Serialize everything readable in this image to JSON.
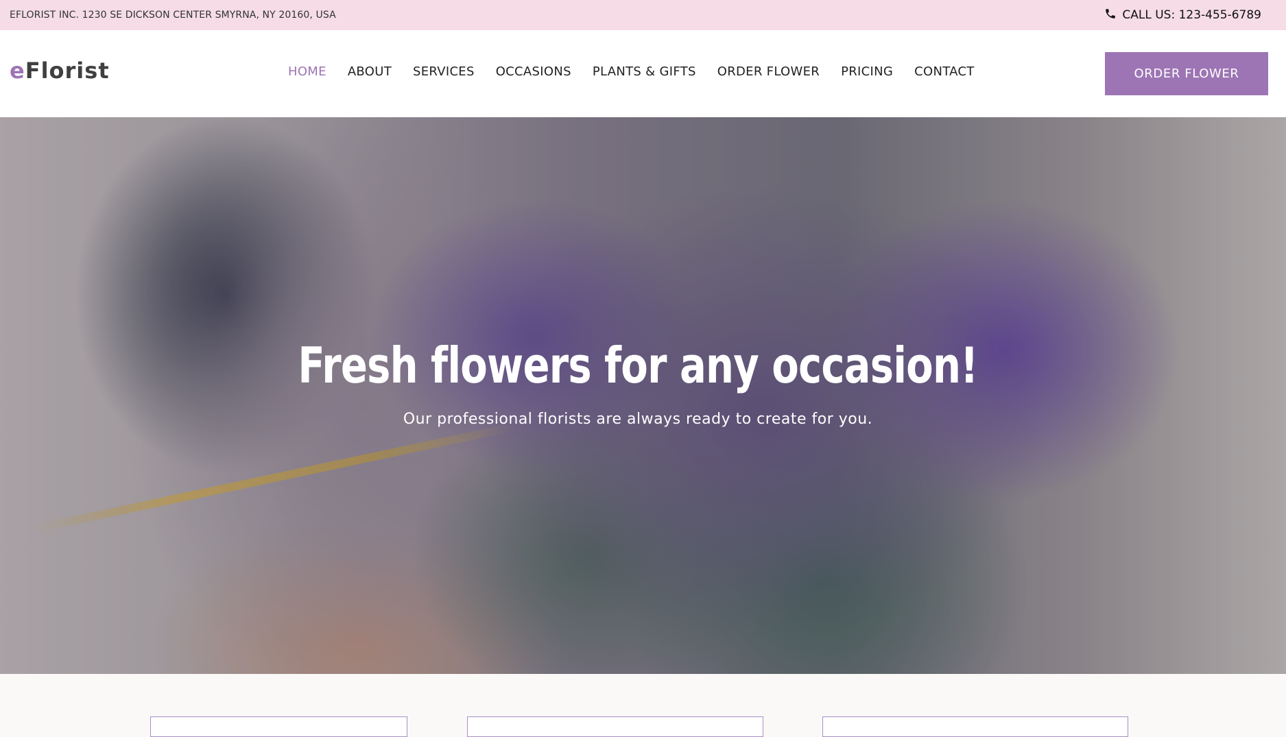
{
  "topbar": {
    "address": "EFLORIST INC. 1230 SE DICKSON CENTER SMYRNA, NY 20160, USA",
    "call": "CALL US: 123-455-6789"
  },
  "header": {
    "logo_prefix": "e",
    "logo_rest": "Florist",
    "nav": [
      {
        "label": "HOME",
        "active": true
      },
      {
        "label": "ABOUT"
      },
      {
        "label": "SERVICES"
      },
      {
        "label": "OCCASIONS"
      },
      {
        "label": "PLANTS & GIFTS"
      },
      {
        "label": "ORDER FLOWER"
      },
      {
        "label": "PRICING"
      },
      {
        "label": "CONTACT"
      }
    ],
    "cta": "ORDER FLOWER"
  },
  "hero": {
    "title": "Fresh flowers for any occasion!",
    "subtitle": "Our professional florists are always ready to create for you."
  },
  "colors": {
    "accent": "#9d75b4",
    "topbar_bg": "#f5dce6"
  }
}
